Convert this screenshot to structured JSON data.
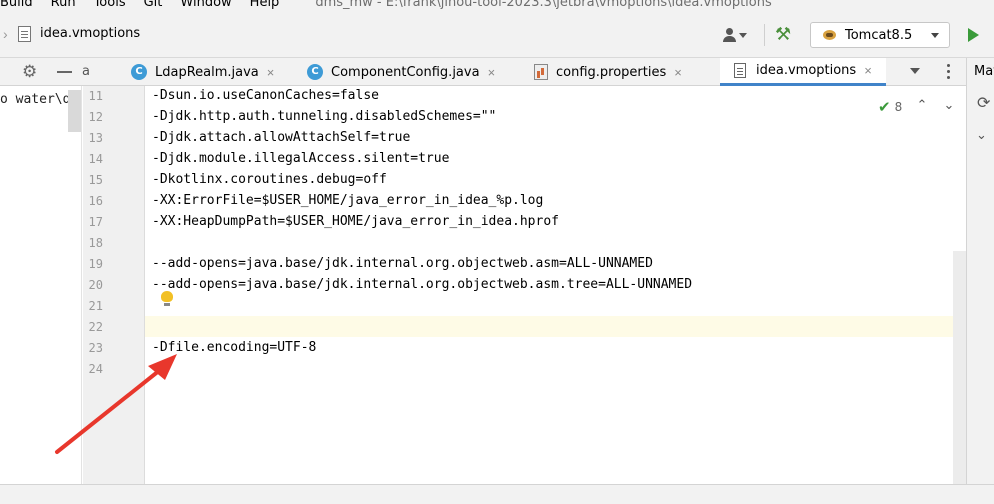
{
  "menu": {
    "items": [
      "Build",
      "Run",
      "Tools",
      "Git",
      "Window",
      "Help"
    ],
    "path": "dms_mw - E:\\frank\\jinou-tool-2023.3\\jetbra\\vmoptions\\idea.vmoptions"
  },
  "navbar": {
    "file": "idea.vmoptions",
    "run_config": "Tomcat8.5",
    "icons": {
      "user": "user-icon",
      "build": "hammer-icon",
      "run": "play-icon"
    }
  },
  "tabs": {
    "overflow_fragment": "a",
    "items": [
      {
        "label": "LdapRealm.java",
        "icon": "class-icon",
        "icon_text": "C",
        "active": false
      },
      {
        "label": "ComponentConfig.java",
        "icon": "class-icon",
        "icon_text": "C",
        "active": false
      },
      {
        "label": "config.properties",
        "icon": "properties-file-icon",
        "active": false
      },
      {
        "label": "idea.vmoptions",
        "icon": "file-icon",
        "active": true
      }
    ],
    "close_glyph": "×"
  },
  "project": {
    "fragment": "o water\\dm"
  },
  "editor": {
    "lines": [
      {
        "num": "11",
        "text": "-Dsun.io.useCanonCaches=false"
      },
      {
        "num": "12",
        "text": "-Djdk.http.auth.tunneling.disabledSchemes=\"\""
      },
      {
        "num": "13",
        "text": "-Djdk.attach.allowAttachSelf=true"
      },
      {
        "num": "14",
        "text": "-Djdk.module.illegalAccess.silent=true"
      },
      {
        "num": "15",
        "text": "-Dkotlinx.coroutines.debug=off"
      },
      {
        "num": "16",
        "text": "-XX:ErrorFile=$USER_HOME/java_error_in_idea_%p.log"
      },
      {
        "num": "17",
        "text": "-XX:HeapDumpPath=$USER_HOME/java_error_in_idea.hprof"
      },
      {
        "num": "18",
        "text": ""
      },
      {
        "num": "19",
        "text": "--add-opens=java.base/jdk.internal.org.objectweb.asm=ALL-UNNAMED"
      },
      {
        "num": "20",
        "text": "--add-opens=java.base/jdk.internal.org.objectweb.asm.tree=ALL-UNNAMED"
      },
      {
        "num": "21",
        "text": ""
      },
      {
        "num": "22",
        "text": ""
      },
      {
        "num": "23",
        "text": "-Dfile.encoding=UTF-8"
      },
      {
        "num": "24",
        "text": ""
      }
    ],
    "inspection_count": "8",
    "current_line_highlight": "#fefbe6"
  },
  "right_panel": {
    "title_fragment": "Mav"
  },
  "colors": {
    "accent": "#4083c9",
    "run_green": "#3a9b3a",
    "annotation_red": "#e8372c"
  }
}
